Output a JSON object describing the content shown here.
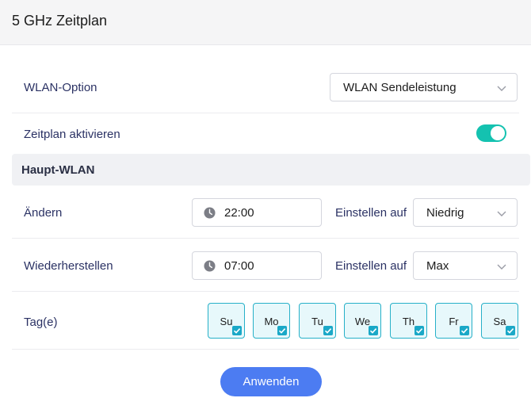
{
  "header": {
    "title": "5 GHz Zeitplan"
  },
  "wlan_option": {
    "label": "WLAN-Option",
    "value": "WLAN Sendeleistung"
  },
  "schedule": {
    "label": "Zeitplan aktivieren",
    "enabled": true
  },
  "section": {
    "title": "Haupt-WLAN"
  },
  "change": {
    "label": "Ändern",
    "time": "22:00",
    "set_label": "Einstellen auf",
    "set_value": "Niedrig"
  },
  "restore": {
    "label": "Wiederherstellen",
    "time": "07:00",
    "set_label": "Einstellen auf",
    "set_value": "Max"
  },
  "days": {
    "label": "Tag(e)",
    "items": [
      {
        "label": "Su",
        "checked": true
      },
      {
        "label": "Mo",
        "checked": true
      },
      {
        "label": "Tu",
        "checked": true
      },
      {
        "label": "We",
        "checked": true
      },
      {
        "label": "Th",
        "checked": true
      },
      {
        "label": "Fr",
        "checked": true
      },
      {
        "label": "Sa",
        "checked": true
      }
    ]
  },
  "apply_label": "Anwenden",
  "icons": {
    "dropdown": "chevron-down-icon",
    "time": "clock-icon",
    "checked": "check-icon"
  },
  "colors": {
    "toggle_on": "#14c2b0",
    "day_border": "#27b0c8",
    "day_bg": "#e7f8fb",
    "button": "#4c7cf2"
  }
}
